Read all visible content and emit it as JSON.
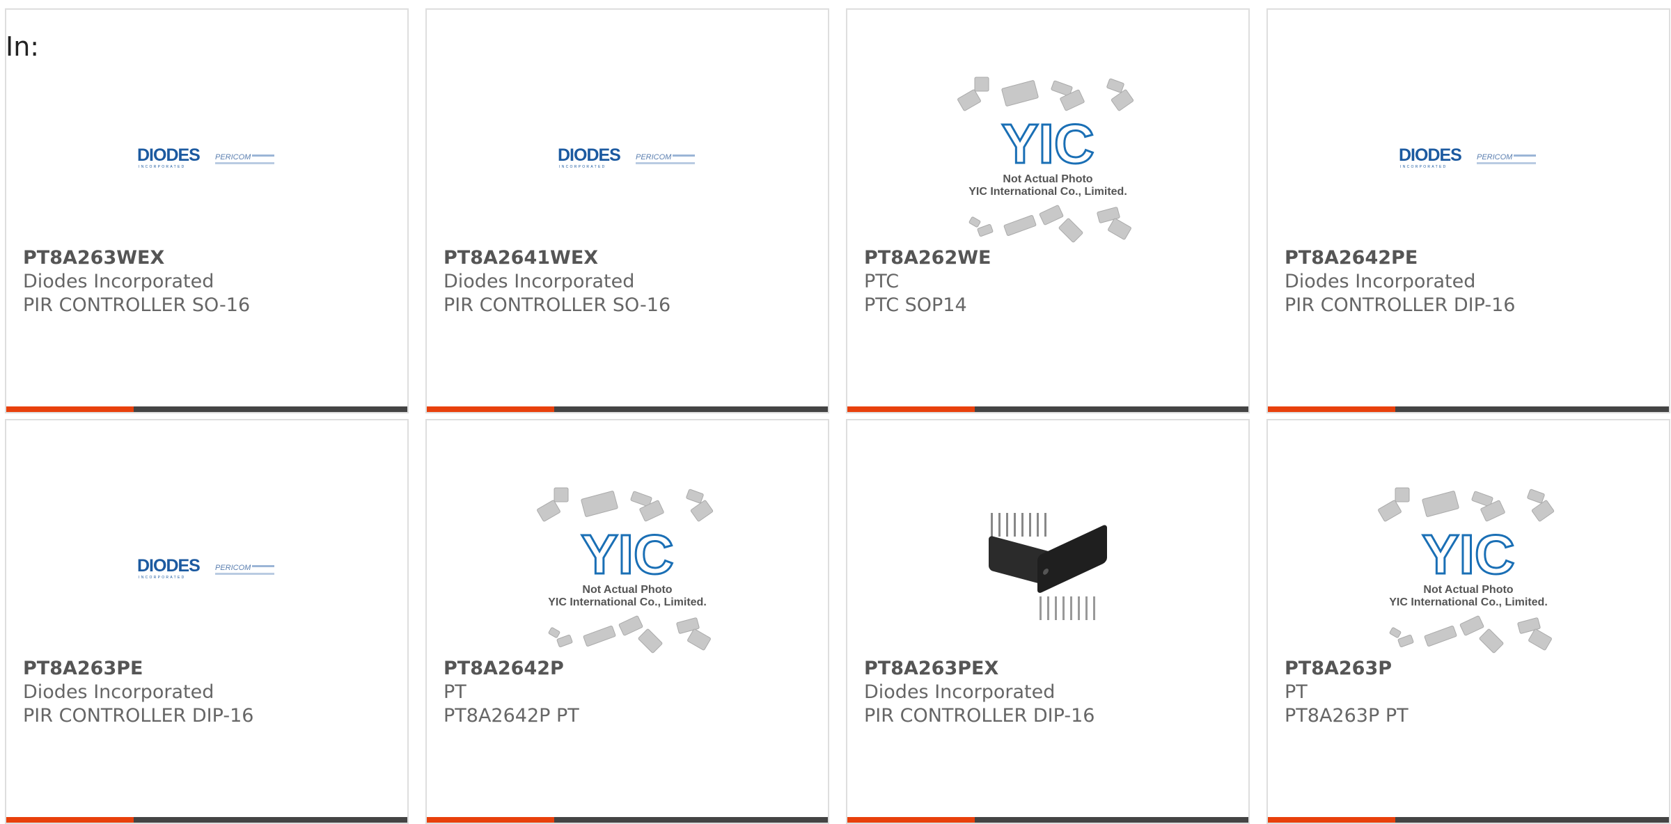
{
  "filter": {
    "label": "In:"
  },
  "colors": {
    "accent": "#e8400c",
    "bar": "#444444",
    "diodes_blue": "#1c5aa0",
    "yic_blue": "#1a6fb5"
  },
  "products": [
    {
      "part": "PT8A263WEX",
      "manufacturer": "Diodes Incorporated",
      "description": "PIR CONTROLLER SO-16",
      "image": "diodes-logo"
    },
    {
      "part": "PT8A2641WEX",
      "manufacturer": "Diodes Incorporated",
      "description": "PIR CONTROLLER SO-16",
      "image": "diodes-logo"
    },
    {
      "part": "PT8A262WE",
      "manufacturer": "PTC",
      "description": "PTC SOP14",
      "image": "yic-placeholder"
    },
    {
      "part": "PT8A2642PE",
      "manufacturer": "Diodes Incorporated",
      "description": "PIR CONTROLLER DIP-16",
      "image": "diodes-logo"
    },
    {
      "part": "PT8A263PE",
      "manufacturer": "Diodes Incorporated",
      "description": "PIR CONTROLLER DIP-16",
      "image": "diodes-logo"
    },
    {
      "part": "PT8A2642P",
      "manufacturer": "PT",
      "description": "PT8A2642P PT",
      "image": "yic-placeholder"
    },
    {
      "part": "PT8A263PEX",
      "manufacturer": "Diodes Incorporated",
      "description": "PIR CONTROLLER DIP-16",
      "image": "dip-chip-photo"
    },
    {
      "part": "PT8A263P",
      "manufacturer": "PT",
      "description": "PT8A263P PT",
      "image": "yic-placeholder"
    }
  ],
  "logos": {
    "diodes": {
      "name": "DIODES",
      "sub": "INCORPORATED",
      "partner": "PERICOM"
    },
    "yic": {
      "name": "YIC",
      "caption_line1": "Not Actual Photo",
      "caption_line2": "YIC International Co., Limited."
    }
  }
}
